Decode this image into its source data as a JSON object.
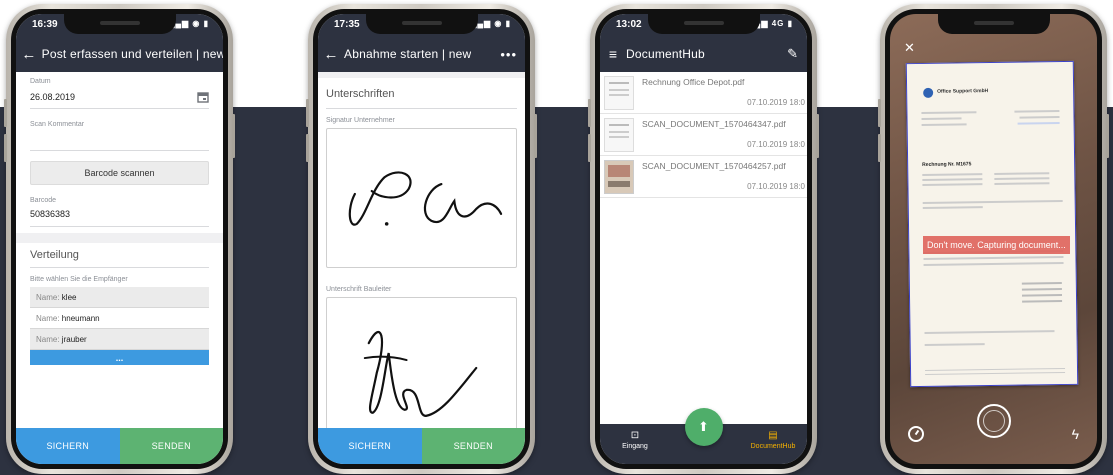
{
  "phone1": {
    "status_time": "16:39",
    "title": "Post erfassen und verteilen | new",
    "date_label": "Datum",
    "date_value": "26.08.2019",
    "scan_comment_label": "Scan Kommentar",
    "barcode_button": "Barcode scannen",
    "barcode_label": "Barcode",
    "barcode_value": "50836383",
    "section_title": "Verteilung",
    "recipients_hint": "Bitte wählen Sie die Empfänger",
    "recipients": [
      {
        "prefix": "Name:",
        "name": "klee"
      },
      {
        "prefix": "Name:",
        "name": "hneumann"
      },
      {
        "prefix": "Name:",
        "name": "jrauber"
      }
    ],
    "more_button": "...",
    "save_label": "SICHERN",
    "send_label": "SENDEN"
  },
  "phone2": {
    "status_time": "17:35",
    "title": "Abnahme starten | new",
    "section_title": "Unterschriften",
    "sig1_label": "Signatur Unternehmer",
    "sig2_label": "Unterschrift Bauleiter",
    "save_label": "SICHERN",
    "send_label": "SENDEN"
  },
  "phone3": {
    "status_time": "13:02",
    "network": "4G",
    "title": "DocumentHub",
    "documents": [
      {
        "name": "Rechnung Office Depot.pdf",
        "date": "07.10.2019 18:0"
      },
      {
        "name": "SCAN_DOCUMENT_1570464347.pdf",
        "date": "07.10.2019 18:0"
      },
      {
        "name": "SCAN_DOCUMENT_1570464257.pdf",
        "date": "07.10.2019 18:0"
      }
    ],
    "nav_inbox": "Eingang",
    "nav_hub": "DocumentHub"
  },
  "phone4": {
    "capture_message": "Don't move. Capturing document...",
    "doc_company": "Office Support GmbH",
    "doc_heading": "Rechnung Nr. M1675"
  },
  "colors": {
    "dark": "#2d3240",
    "save": "#3d9ae0",
    "send": "#5db372",
    "accent": "#f5b100",
    "capture": "#e0675f"
  }
}
